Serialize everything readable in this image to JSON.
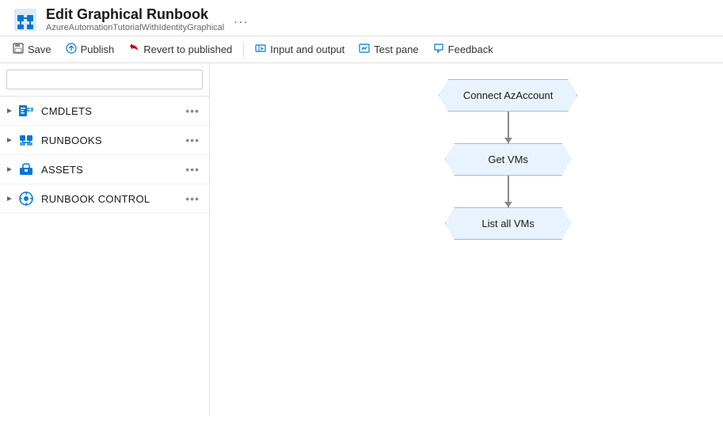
{
  "header": {
    "title": "Edit Graphical Runbook",
    "subtitle": "AzureAutomationTutorialWithIdentityGraphical",
    "ellipsis": "..."
  },
  "toolbar": {
    "save_label": "Save",
    "publish_label": "Publish",
    "revert_label": "Revert to published",
    "input_output_label": "Input and output",
    "test_pane_label": "Test pane",
    "feedback_label": "Feedback"
  },
  "sidebar": {
    "search_placeholder": "",
    "items": [
      {
        "id": "cmdlets",
        "label": "CMDLETS",
        "icon": "cmdlets"
      },
      {
        "id": "runbooks",
        "label": "RUNBOOKS",
        "icon": "runbooks"
      },
      {
        "id": "assets",
        "label": "ASSETS",
        "icon": "assets"
      },
      {
        "id": "runbook-control",
        "label": "RUNBOOK CONTROL",
        "icon": "runbook-control"
      }
    ]
  },
  "canvas": {
    "nodes": [
      {
        "id": "node1",
        "label": "Connect AzAccount"
      },
      {
        "id": "node2",
        "label": "Get VMs"
      },
      {
        "id": "node3",
        "label": "List all VMs"
      }
    ]
  }
}
